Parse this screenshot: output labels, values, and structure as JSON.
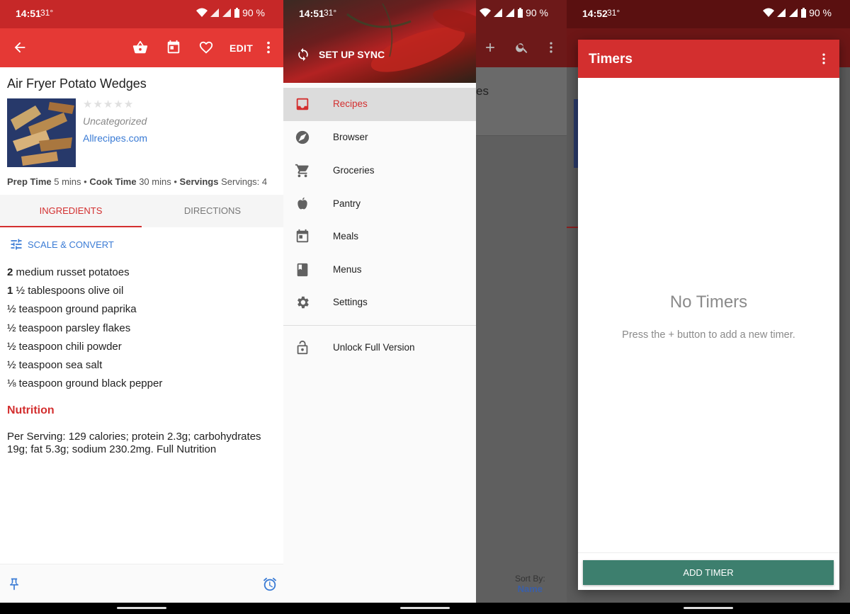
{
  "screen1": {
    "status": {
      "time": "14:51",
      "temp": "31°",
      "battery": "90 %"
    },
    "toolbar": {
      "edit_label": "EDIT"
    },
    "recipe": {
      "title": "Air Fryer Potato Wedges",
      "rating_stars": "★★★★★",
      "category": "Uncategorized",
      "source": "Allrecipes.com",
      "prep_label": "Prep Time",
      "prep_value": "5 mins",
      "cook_label": "Cook Time",
      "cook_value": "30 mins",
      "servings_label": "Servings",
      "servings_value": "Servings: 4",
      "separator": "•"
    },
    "tabs": {
      "ingredients": "INGREDIENTS",
      "directions": "DIRECTIONS"
    },
    "scale_convert": "SCALE & CONVERT",
    "ingredients": [
      {
        "qty": "2",
        "text": "medium russet potatoes"
      },
      {
        "qty": "1",
        "text": "½ tablespoons olive oil"
      },
      {
        "qty": "",
        "text": "½ teaspoon ground paprika"
      },
      {
        "qty": "",
        "text": "½ teaspoon parsley flakes"
      },
      {
        "qty": "",
        "text": "½ teaspoon chili powder"
      },
      {
        "qty": "",
        "text": "½ teaspoon sea salt"
      },
      {
        "qty": "",
        "text": "⅛ teaspoon ground black pepper"
      }
    ],
    "nutrition": {
      "heading": "Nutrition",
      "text": "Per Serving: 129 calories; protein 2.3g; carbohydrates 19g; fat 5.3g; sodium 230.2mg. Full Nutrition"
    }
  },
  "screen2": {
    "status": {
      "time": "14:51",
      "temp": "31°",
      "battery": "90 %"
    },
    "sync_label": "SET UP SYNC",
    "menu": [
      {
        "label": "Recipes",
        "icon": "inbox-icon",
        "selected": true
      },
      {
        "label": "Browser",
        "icon": "compass-icon"
      },
      {
        "label": "Groceries",
        "icon": "cart-icon"
      },
      {
        "label": "Pantry",
        "icon": "apple-icon"
      },
      {
        "label": "Meals",
        "icon": "calendar-icon"
      },
      {
        "label": "Menus",
        "icon": "book-icon"
      },
      {
        "label": "Settings",
        "icon": "gear-icon"
      }
    ],
    "unlock_label": "Unlock Full Version",
    "behind_fragment": "es",
    "sort_label": "Sort By:",
    "sort_value": "Name"
  },
  "screen3": {
    "status": {
      "time": "14:52",
      "temp": "31°",
      "battery": "90 %"
    },
    "dialog_title": "Timers",
    "empty_title": "No Timers",
    "empty_subtitle": "Press the + button to add a new timer.",
    "add_button": "ADD TIMER"
  },
  "colors": {
    "primary": "#e53935",
    "accent_green": "#3d7f6e",
    "link_blue": "#3a7bd5"
  }
}
